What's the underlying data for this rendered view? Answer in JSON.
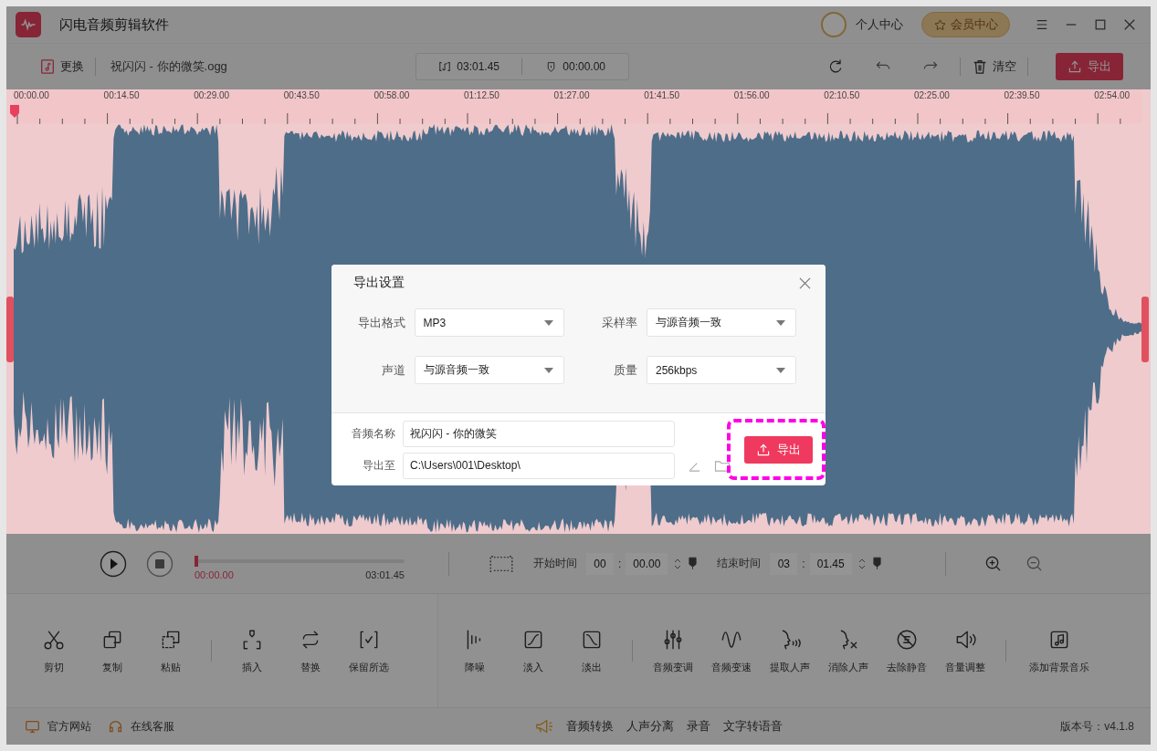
{
  "window": {
    "title": "闪电音频剪辑软件",
    "user_center": "个人中心",
    "vip_center": "会员中心"
  },
  "toolbar": {
    "replace": "更换",
    "file_name": "祝闪闪 - 你的微笑.ogg",
    "duration": "03:01.45",
    "position": "00:00.00",
    "clear": "清空",
    "export": "导出"
  },
  "timeline": {
    "ticks": [
      "00:00.00",
      "00:14.50",
      "00:29.00",
      "00:43.50",
      "00:58.00",
      "01:12.50",
      "01:27.00",
      "01:41.50",
      "01:56.00",
      "02:10.50",
      "02:25.00",
      "02:39.50",
      "02:54.00"
    ]
  },
  "playback": {
    "level": 0,
    "current": "00:00.00",
    "total": "03:01.45",
    "start_label": "开始时间",
    "start_min": "00",
    "start_separator": ":",
    "start_sec": "00.00",
    "end_label": "结束时间",
    "end_min": "03",
    "end_separator": ":",
    "end_sec": "01.45"
  },
  "edit_tools": [
    [
      "剪切",
      "复制",
      "粘贴"
    ],
    [
      "插入",
      "替换",
      "保留所选"
    ]
  ],
  "effect_tools": [
    [
      "降噪",
      "淡入",
      "淡出"
    ],
    [
      "音频变调",
      "音频变速",
      "提取人声",
      "消除人声",
      "去除静音",
      "音量调整"
    ],
    [
      "添加背景音乐"
    ]
  ],
  "status_bar": {
    "links": [
      "官方网站",
      "在线客服"
    ],
    "features": [
      "音频转换",
      "人声分离",
      "录音",
      "文字转语音"
    ],
    "version": "版本号：v4.1.8"
  },
  "dialog": {
    "title": "导出设置",
    "fields": [
      {
        "label": "导出格式",
        "value": "MP3"
      },
      {
        "label": "采样率",
        "value": "与源音频一致"
      },
      {
        "label": "声道",
        "value": "与源音频一致"
      },
      {
        "label": "质量",
        "value": "256kbps"
      }
    ],
    "name_label": "音频名称",
    "name_value": "祝闪闪 - 你的微笑",
    "path_label": "导出至",
    "path_value": "C:\\Users\\001\\Desktop\\",
    "export": "导出"
  }
}
